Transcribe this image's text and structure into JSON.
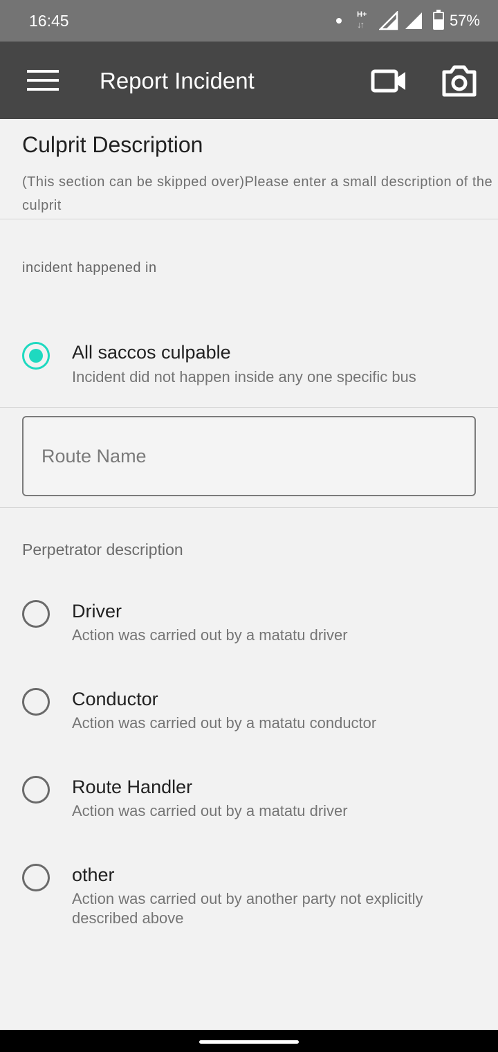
{
  "status_bar": {
    "time": "16:45",
    "network_type": "H+",
    "battery": "57%",
    "icons": [
      "notification-dot",
      "network-data-icon",
      "signal-icon",
      "signal-icon",
      "battery-icon"
    ]
  },
  "app_bar": {
    "title": "Report Incident",
    "icons": [
      "menu-icon",
      "video-camera-icon",
      "camera-icon"
    ]
  },
  "culprit_section": {
    "title": "Culprit Description",
    "subtitle": "(This section can be skipped over)Please enter a small description of the culprit",
    "location_label": "incident happened in"
  },
  "location_options": [
    {
      "label": "All saccos culpable",
      "description": "Incident did not happen inside any one specific bus",
      "selected": true
    }
  ],
  "route_field": {
    "placeholder": "Route Name",
    "value": ""
  },
  "perpetrator_section": {
    "label": "Perpetrator description",
    "options": [
      {
        "label": "Driver",
        "description": "Action was carried out by a matatu driver",
        "selected": false
      },
      {
        "label": "Conductor",
        "description": "Action was carried out by a matatu conductor",
        "selected": false
      },
      {
        "label": "Route Handler",
        "description": "Action was carried out by a matatu driver",
        "selected": false
      },
      {
        "label": "other",
        "description": "Action was carried out by another party not explicitly described above",
        "selected": false
      }
    ]
  },
  "colors": {
    "status_bar": "#747474",
    "app_bar": "#464646",
    "background": "#f2f2f2",
    "accent": "#1ed9c0"
  }
}
